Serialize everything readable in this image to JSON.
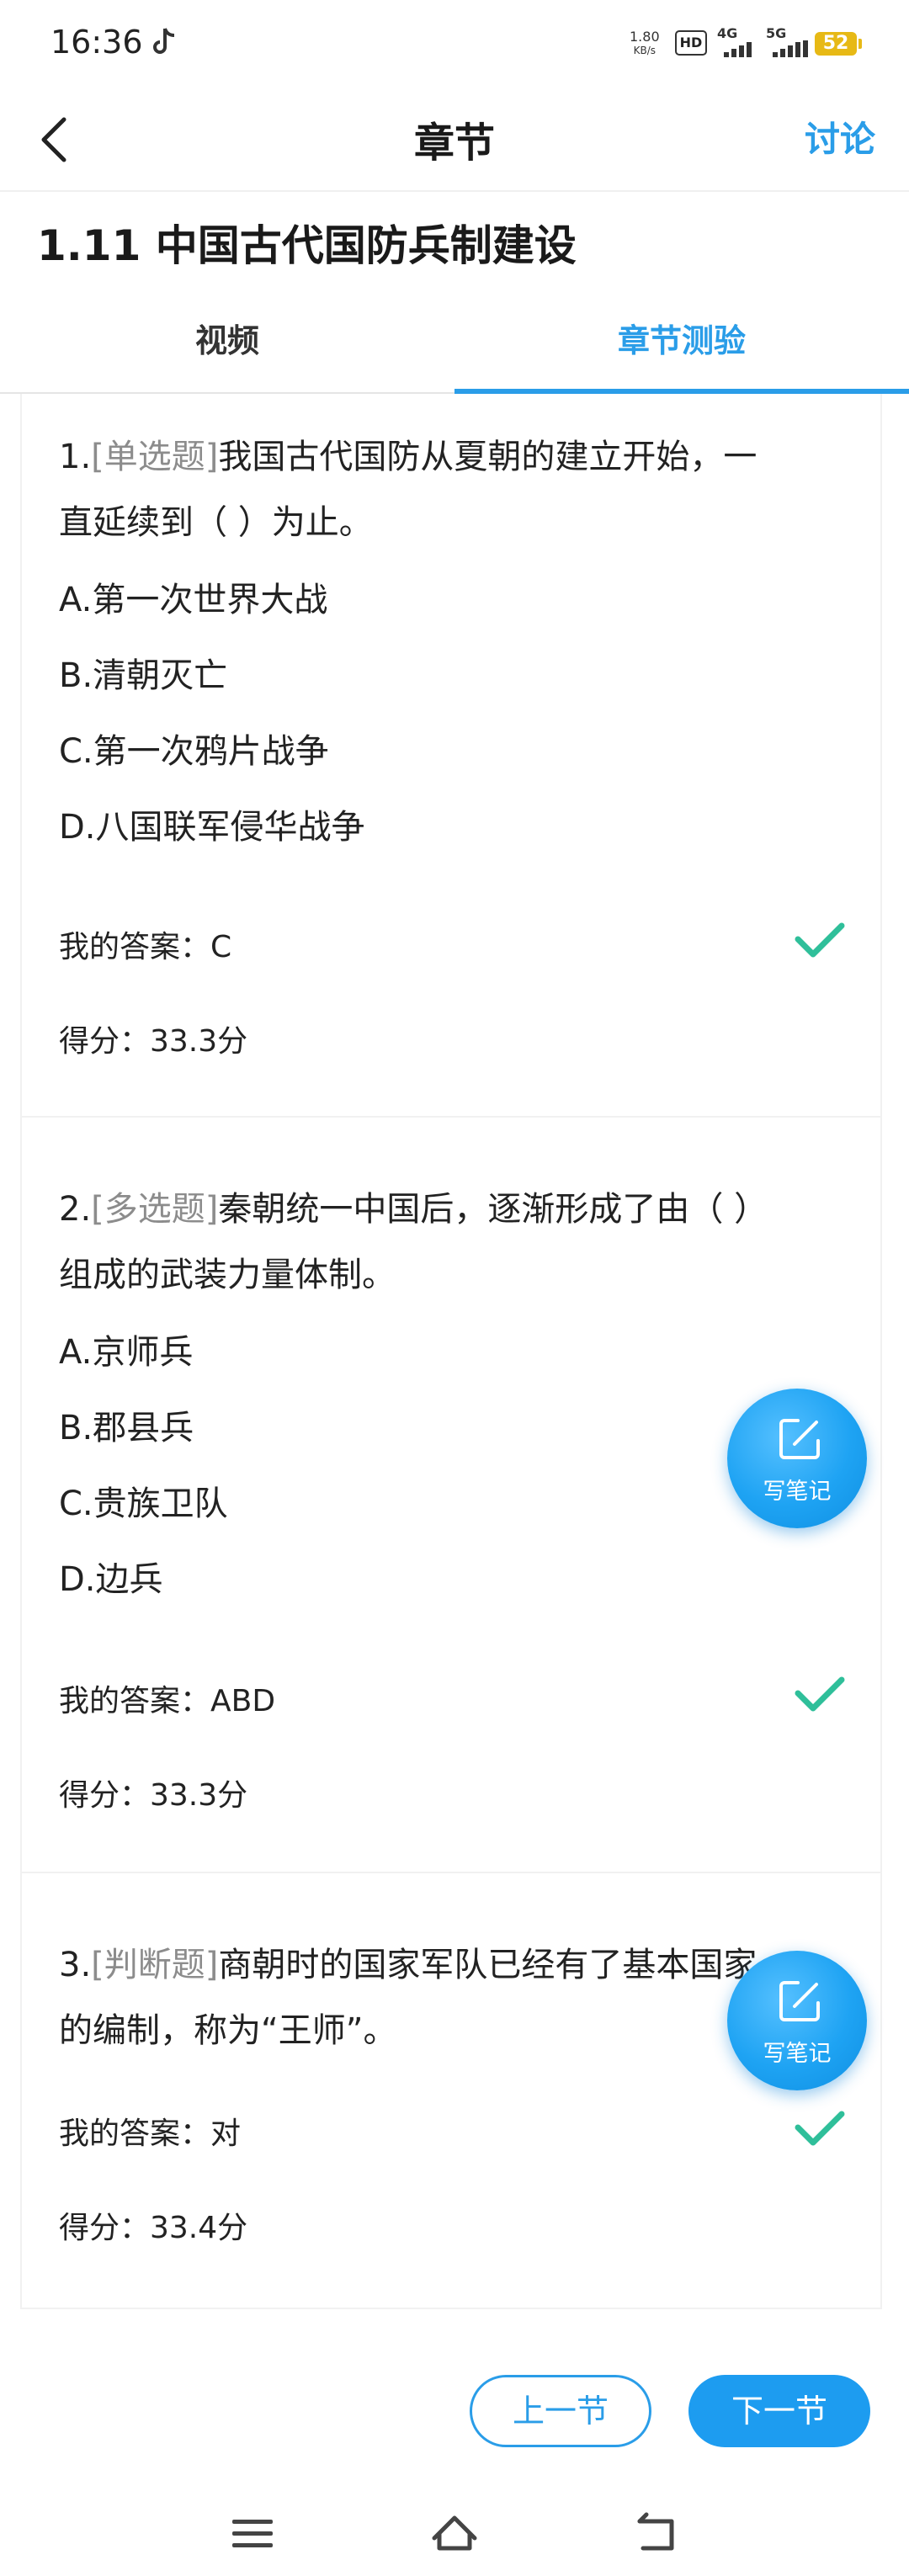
{
  "status_bar": {
    "time": "16:36",
    "net_speed_value": "1.80",
    "net_speed_unit": "KB/s",
    "hd_label": "HD",
    "sig1_label": "4G",
    "sig2_label": "5G",
    "battery": "52"
  },
  "header": {
    "title": "章节",
    "discuss_label": "讨论"
  },
  "chapter": {
    "title": "1.11 中国古代国防兵制建设"
  },
  "tabs": [
    {
      "label": "视频",
      "active": false
    },
    {
      "label": "章节测验",
      "active": true
    }
  ],
  "questions": [
    {
      "number": "1.",
      "type": "[单选题]",
      "text_line1": "我国古代国防从夏朝的建立开始，一",
      "text_line2": "直延续到（ ）为止。",
      "options": [
        "A.第一次世界大战",
        "B.清朝灭亡",
        "C.第一次鸦片战争",
        "D.八国联军侵华战争"
      ],
      "answer": "我的答案：C",
      "score": "得分：33.3分"
    },
    {
      "number": "2.",
      "type": "[多选题]",
      "text_line1": "秦朝统一中国后，逐渐形成了由（ ）",
      "text_line2": "组成的武装力量体制。",
      "options": [
        "A.京师兵",
        "B.郡县兵",
        "C.贵族卫队",
        "D.边兵"
      ],
      "answer": "我的答案：ABD",
      "score": "得分：33.3分"
    },
    {
      "number": "3.",
      "type": "[判断题]",
      "text_line1": "商朝时的国家军队已经有了基本国家",
      "text_line2": "的编制，称为“王师”。",
      "options": [],
      "answer": "我的答案：对",
      "score": "得分：33.4分"
    }
  ],
  "note_button": {
    "label": "写笔记"
  },
  "bottom_nav": {
    "prev_label": "上一节",
    "next_label": "下一节"
  },
  "colors": {
    "accent": "#2a9de8",
    "check": "#2fbf9a",
    "type_tag": "#8c8c8c"
  }
}
